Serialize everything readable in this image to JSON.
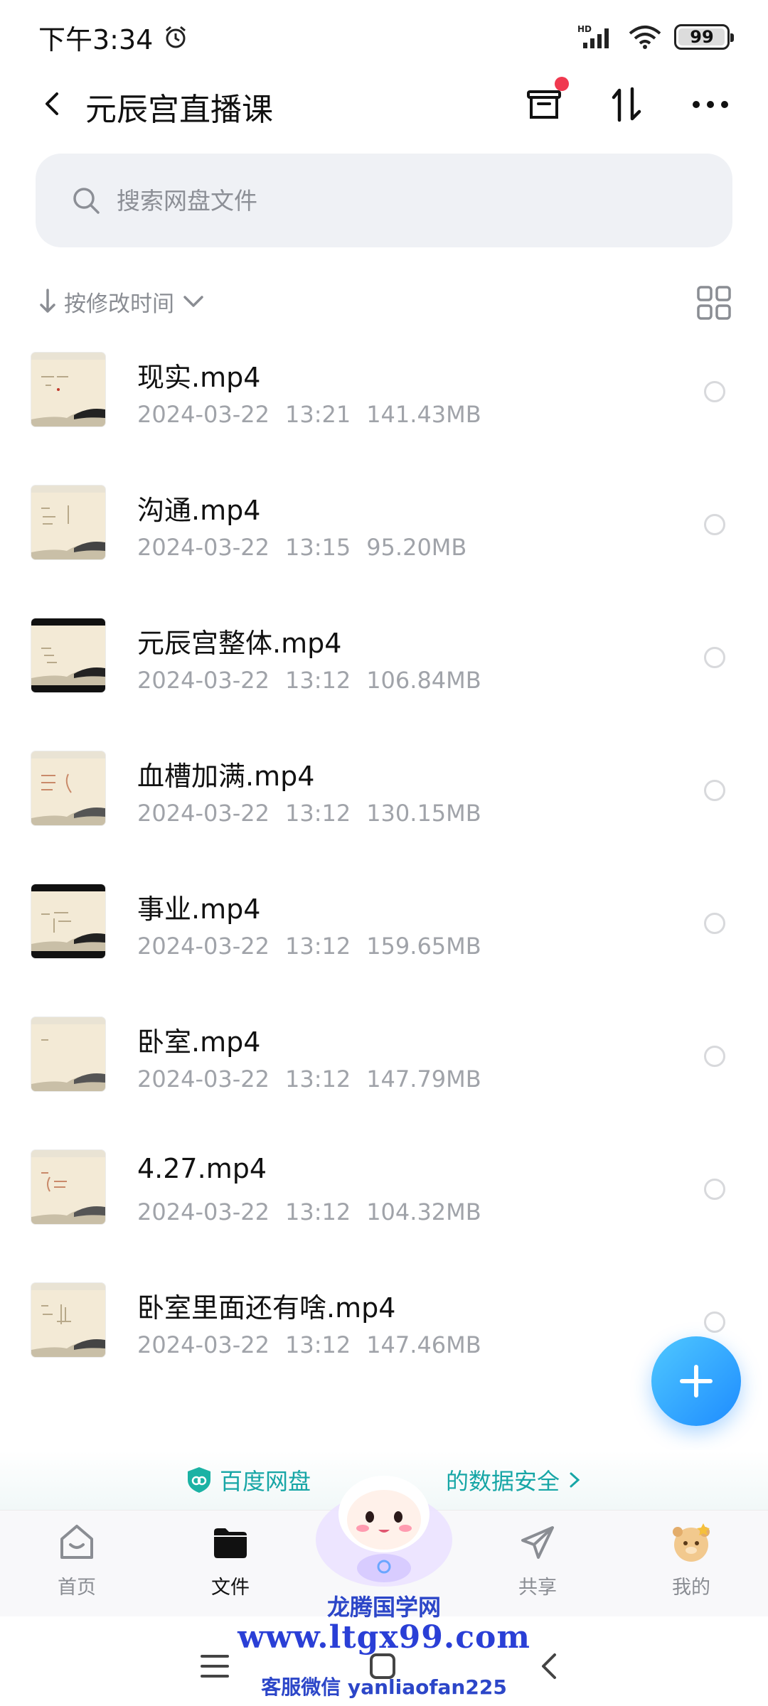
{
  "status_bar": {
    "time": "下午3:34",
    "network": "HD",
    "battery": "99",
    "battery_level": 0.99
  },
  "header": {
    "title": "元辰宫直播课"
  },
  "search": {
    "placeholder": "搜索网盘文件"
  },
  "sort": {
    "label": "按修改时间"
  },
  "files": [
    {
      "name": "现实.mp4",
      "date": "2024-03-22",
      "time": "13:21",
      "size": "141.43MB"
    },
    {
      "name": "沟通.mp4",
      "date": "2024-03-22",
      "time": "13:15",
      "size": "95.20MB"
    },
    {
      "name": "元辰宫整体.mp4",
      "date": "2024-03-22",
      "time": "13:12",
      "size": "106.84MB"
    },
    {
      "name": "血槽加满.mp4",
      "date": "2024-03-22",
      "time": "13:12",
      "size": "130.15MB"
    },
    {
      "name": "事业.mp4",
      "date": "2024-03-22",
      "time": "13:12",
      "size": "159.65MB"
    },
    {
      "name": "卧室.mp4",
      "date": "2024-03-22",
      "time": "13:12",
      "size": "147.79MB"
    },
    {
      "name": "4.27.mp4",
      "date": "2024-03-22",
      "time": "13:12",
      "size": "104.32MB"
    },
    {
      "name": "卧室里面还有啥.mp4",
      "date": "2024-03-22",
      "time": "13:12",
      "size": "147.46MB"
    }
  ],
  "security_banner": {
    "text_left": "百度网盘",
    "text_right": "的数据安全"
  },
  "bottom_nav": {
    "items": [
      {
        "label": "首页",
        "icon": "home-icon"
      },
      {
        "label": "文件",
        "icon": "folder-icon"
      },
      {
        "label": "",
        "icon": "mascot"
      },
      {
        "label": "共享",
        "icon": "share-icon"
      },
      {
        "label": "我的",
        "icon": "profile-avatar"
      }
    ]
  },
  "watermark": {
    "line1": "龙腾国学网",
    "line2": "www.ltgx99.com",
    "line3": "客服微信 yanliaofan225"
  },
  "colors": {
    "accent": "#1e8cff",
    "security": "#17a6a6",
    "badge": "#f0394f"
  }
}
